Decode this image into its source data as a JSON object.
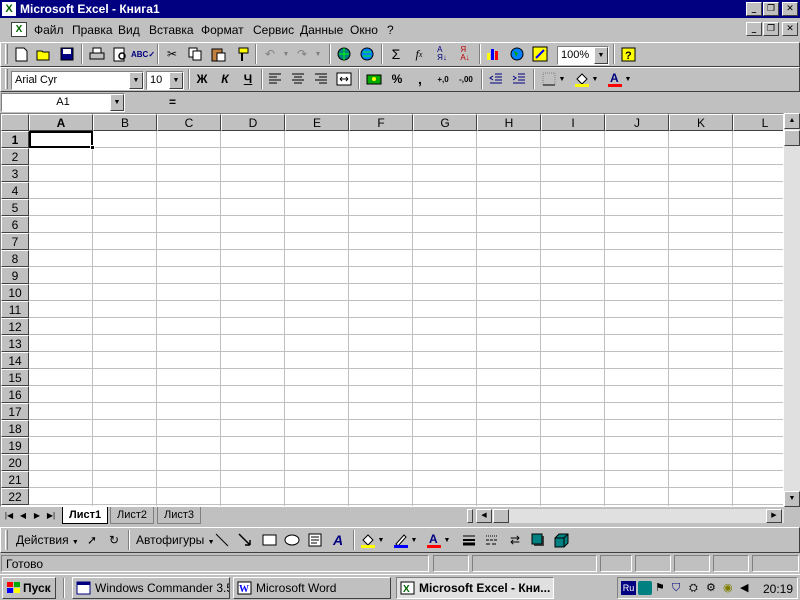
{
  "window": {
    "title": "Microsoft Excel - Книга1",
    "app_icon": "excel-x-icon"
  },
  "menu": [
    "Файл",
    "Правка",
    "Вид",
    "Вставка",
    "Формат",
    "Сервис",
    "Данные",
    "Окно",
    "?"
  ],
  "toolbar_standard": {
    "zoom": "100%"
  },
  "toolbar_format": {
    "font": "Arial Cyr",
    "size": "10",
    "bold": "Ж",
    "italic": "К",
    "underline": "Ч",
    "percent": "%",
    "comma": ",",
    "inc_decimal": ",0→,00",
    "dec_decimal": ",00→,0"
  },
  "formula_bar": {
    "name_box": "A1",
    "equals": "=",
    "formula": ""
  },
  "grid": {
    "columns": [
      "A",
      "B",
      "C",
      "D",
      "E",
      "F",
      "G",
      "H",
      "I",
      "J",
      "K",
      "L"
    ],
    "rows": [
      "1",
      "2",
      "3",
      "4",
      "5",
      "6",
      "7",
      "8",
      "9",
      "10",
      "11",
      "12",
      "13",
      "14",
      "15",
      "16",
      "17",
      "18",
      "19",
      "20",
      "21",
      "22"
    ],
    "active_cell": "A1"
  },
  "sheets": [
    "Лист1",
    "Лист2",
    "Лист3"
  ],
  "active_sheet": "Лист1",
  "drawing": {
    "actions": "Действия",
    "autoshapes": "Автофигуры"
  },
  "status": {
    "text": "Готово"
  },
  "taskbar": {
    "start": "Пуск",
    "tasks": [
      "Windows Commander 3.52...",
      "Microsoft Word",
      "Microsoft Excel - Кни..."
    ],
    "active_task": 2,
    "lang": "Ru",
    "clock": "20:19"
  },
  "colors": {
    "title_bg": "#000080",
    "face": "#c0c0c0",
    "highlight_yellow": "#ffff00",
    "font_red": "#ff0000"
  }
}
